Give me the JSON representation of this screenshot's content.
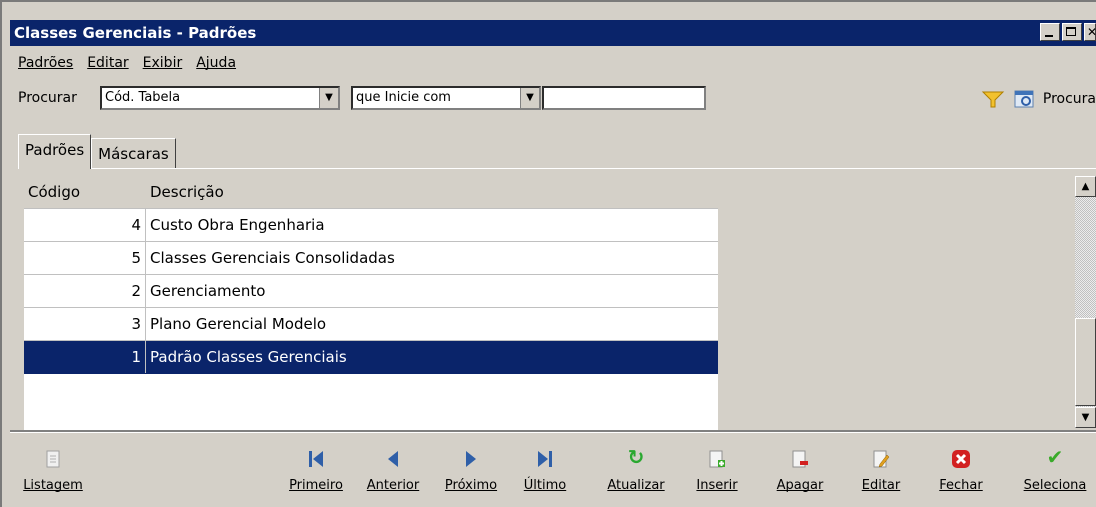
{
  "window": {
    "title": "Classes Gerenciais - Padrões"
  },
  "menu": {
    "items": [
      "Padrões",
      "Editar",
      "Exibir",
      "Ajuda"
    ]
  },
  "search": {
    "label": "Procurar",
    "field_value": "Cód. Tabela",
    "mode_value": "que Inicie com",
    "text_value": "",
    "button_label": "Procura"
  },
  "tabs": [
    "Padrões",
    "Máscaras"
  ],
  "grid": {
    "columns": [
      "Código",
      "Descrição"
    ],
    "rows": [
      {
        "code": "4",
        "desc": "Custo Obra Engenharia"
      },
      {
        "code": "5",
        "desc": "Classes Gerenciais Consolidadas"
      },
      {
        "code": "2",
        "desc": "Gerenciamento"
      },
      {
        "code": "3",
        "desc": "Plano Gerencial Modelo"
      },
      {
        "code": "1",
        "desc": "Padrão Classes Gerenciais"
      }
    ],
    "selected_index": 4
  },
  "toolbar": {
    "listagem": "Listagem",
    "primeiro": "Primeiro",
    "anterior": "Anterior",
    "proximo": "Próximo",
    "ultimo": "Último",
    "atualizar": "Atualizar",
    "inserir": "Inserir",
    "apagar": "Apagar",
    "editar": "Editar",
    "fechar": "Fechar",
    "seleciona": "Seleciona"
  },
  "colors": {
    "titlebar": "#0a246a",
    "selection": "#0a246a",
    "nav": "#2f5fa8",
    "refresh": "#2aa830",
    "close": "#d22020",
    "check": "#3aaa2a"
  }
}
